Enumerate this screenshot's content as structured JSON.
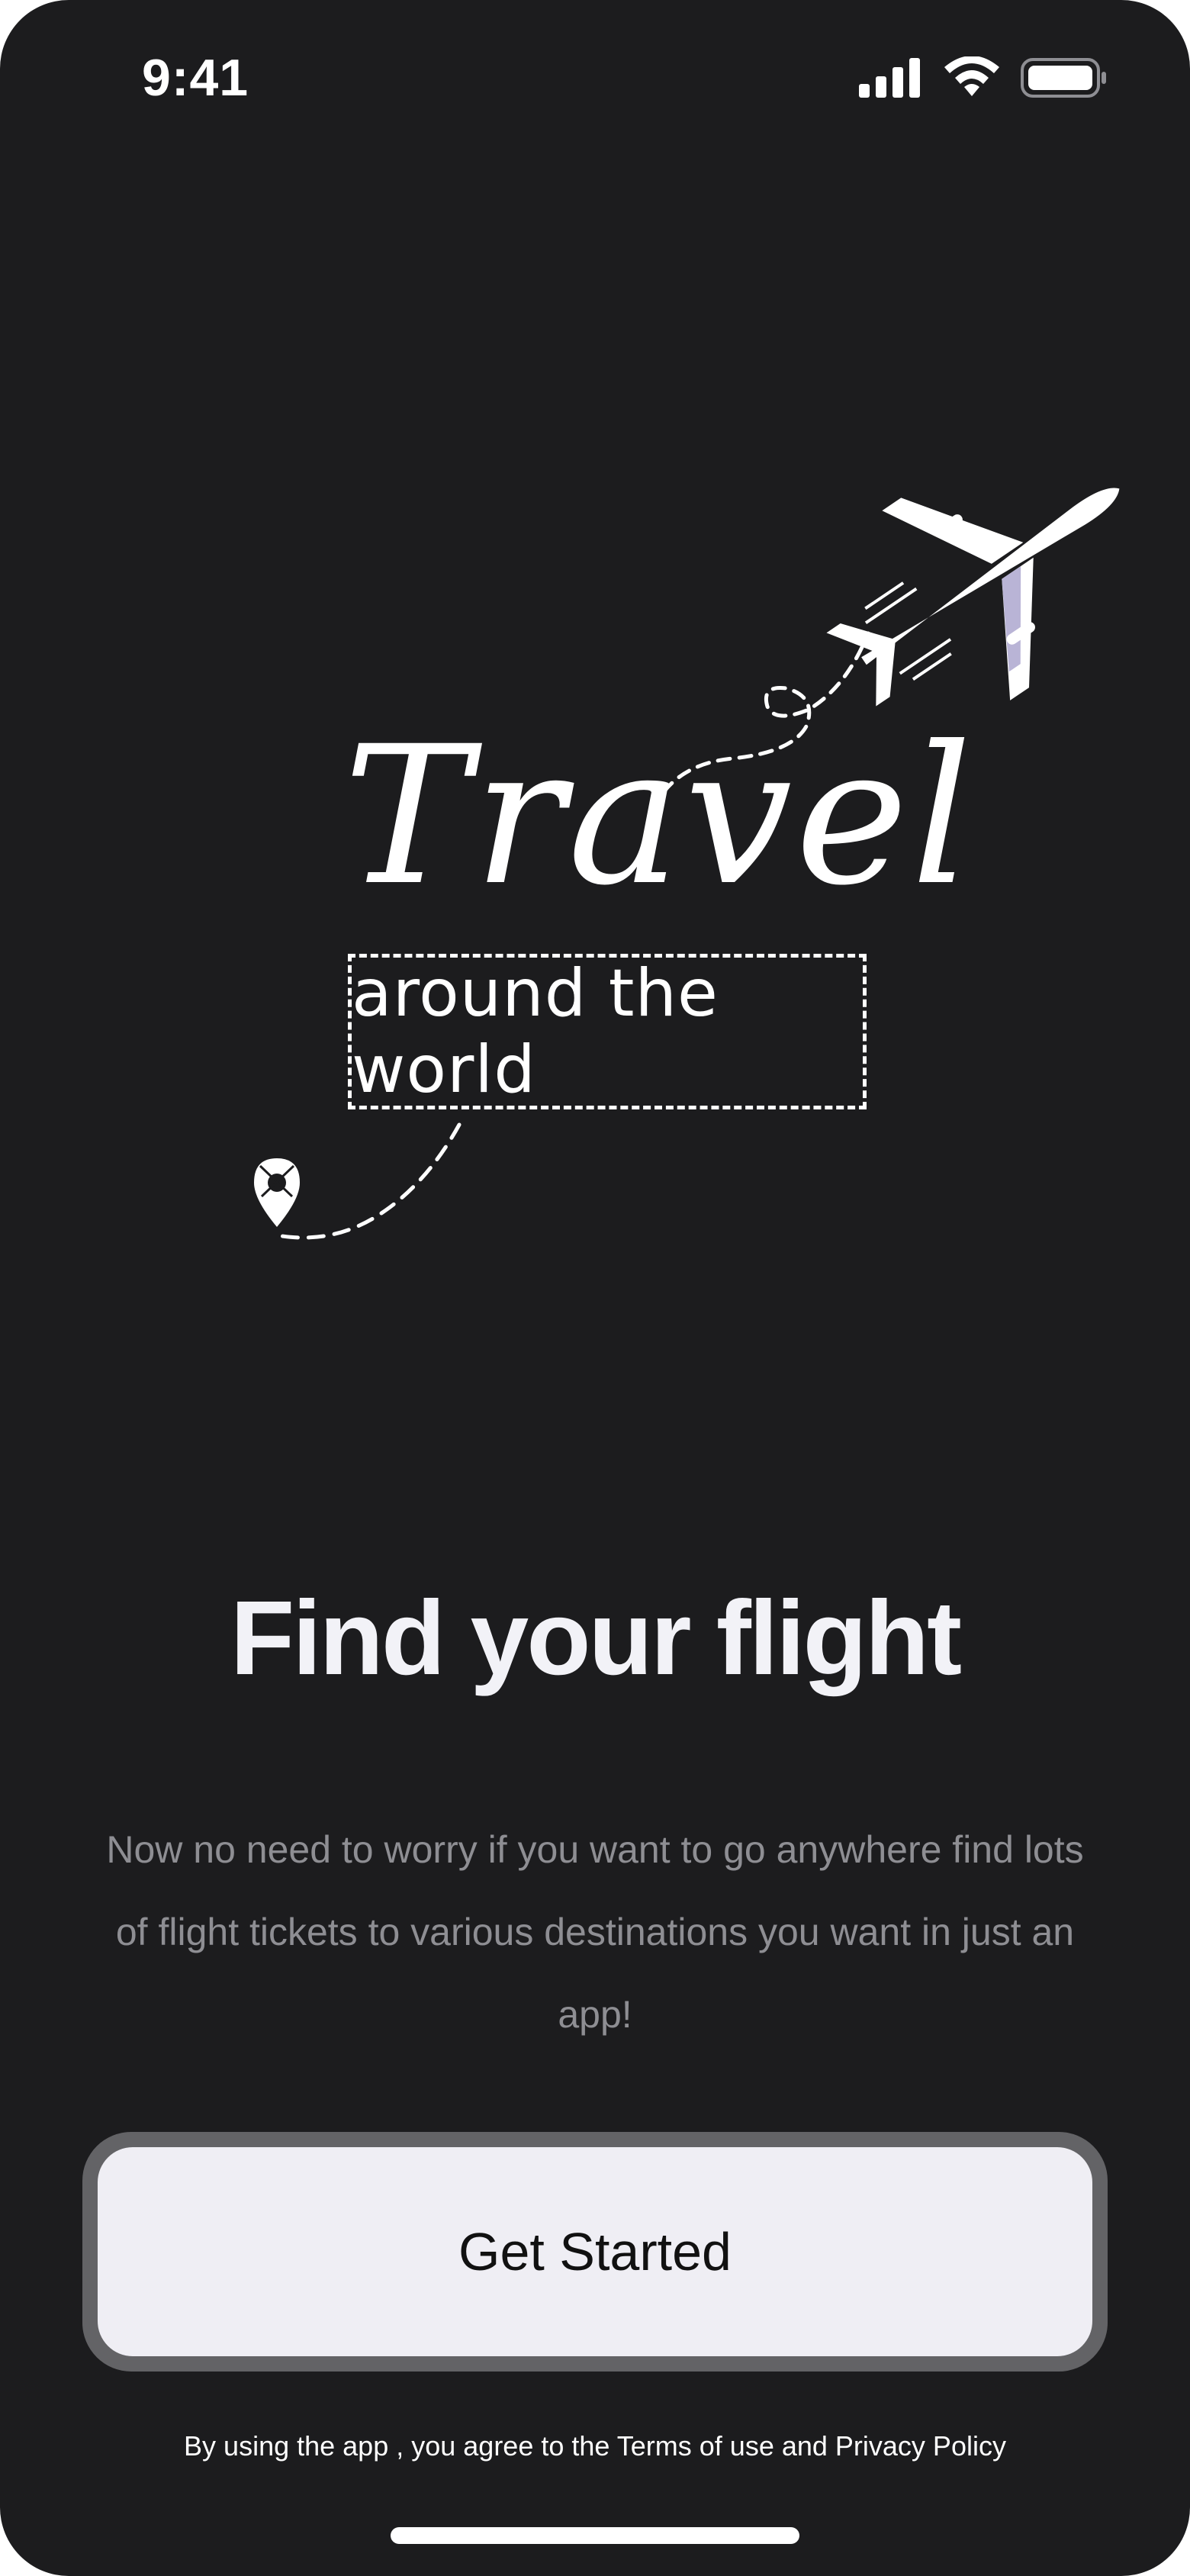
{
  "status_bar": {
    "time": "9:41",
    "icons": [
      "cellular-signal-icon",
      "wifi-icon",
      "battery-icon"
    ]
  },
  "illustration": {
    "title": "Travel",
    "tagline": "around the world",
    "icons": [
      "airplane-icon",
      "location-pin-icon"
    ]
  },
  "onboarding": {
    "headline": "Find your flight",
    "description": "Now no need to worry if you want to go anywhere find lots of flight tickets to various destinations you want in just an app!",
    "cta_label": "Get Started",
    "terms": "By using the app , you agree to the Terms of use and Privacy Policy"
  },
  "colors": {
    "background": "#1c1c1e",
    "headline": "#f2f2f7",
    "body_text": "#8e8e93",
    "button_fill": "#efeef4",
    "button_ring": "#636366",
    "plane_shadow": "#b9b4d6"
  }
}
